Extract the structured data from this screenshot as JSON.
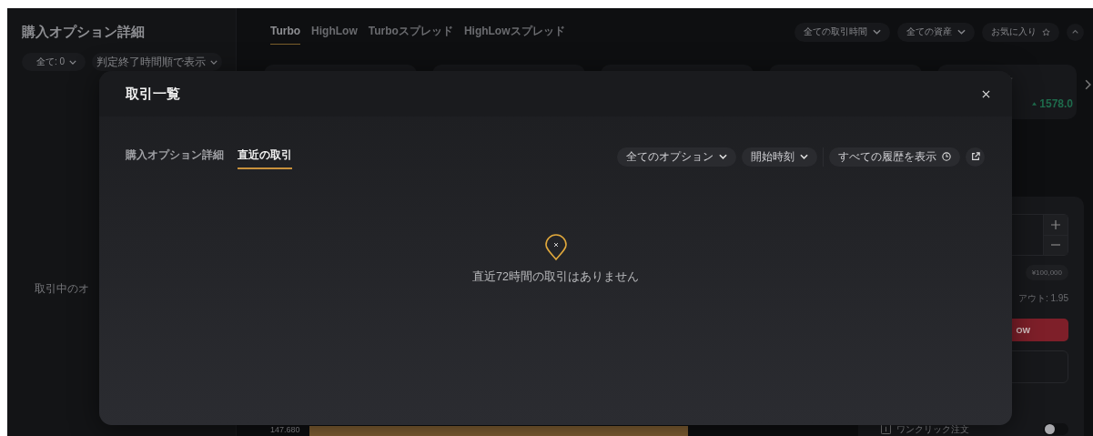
{
  "sidebar": {
    "title": "購入オプション詳細",
    "filters": [
      {
        "label": "全て: 0"
      },
      {
        "label": "判定終了時間順で表示"
      }
    ],
    "empty_text": "取引中のオ"
  },
  "product_tabs": [
    {
      "label": "Turbo",
      "selected": true
    },
    {
      "label": "HighLow",
      "selected": false
    },
    {
      "label": "Turboスプレッド",
      "selected": false
    },
    {
      "label": "HighLowスプレッド",
      "selected": false
    }
  ],
  "header_buttons": [
    {
      "label": "全ての取引時間",
      "kind": "dropdown"
    },
    {
      "label": "全ての資産",
      "kind": "dropdown"
    },
    {
      "label": "お気に入り",
      "kind": "favorite"
    }
  ],
  "ticker": {
    "change": "1578.0"
  },
  "trade_panel": {
    "amount_preset": "¥100,000",
    "payout": "アウト: 1.95",
    "low_button": "OW",
    "one_click": {
      "label": "ワンクリック注文",
      "on": false
    }
  },
  "chart": {
    "y_label": "147.680"
  },
  "modal": {
    "title": "取引一覧",
    "tabs": [
      {
        "label": "購入オプション詳細",
        "selected": false
      },
      {
        "label": "直近の取引",
        "selected": true
      }
    ],
    "filters": [
      {
        "label": "全てのオプション",
        "kind": "dropdown"
      },
      {
        "label": "開始時刻",
        "kind": "dropdown"
      },
      {
        "label": "すべての履歴を表示",
        "kind": "history"
      }
    ],
    "empty_message": "直近72時間の取引はありません"
  }
}
